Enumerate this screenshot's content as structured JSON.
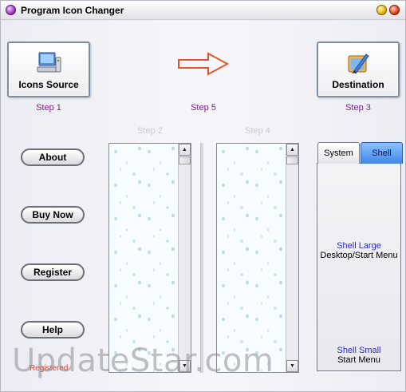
{
  "window": {
    "title": "Program Icon Changer"
  },
  "toolbar": {
    "icons_source_label": "Icons Source",
    "destination_label": "Destination",
    "step1": "Step 1",
    "step5": "Step 5",
    "step3": "Step 3",
    "step2": "Step 2",
    "step4": "Step 4"
  },
  "sidebar": {
    "about": "About",
    "buy_now": "Buy Now",
    "register": "Register",
    "help": "Help"
  },
  "tabs": {
    "system": "System",
    "shell": "Shell"
  },
  "panel": {
    "shell_large": "Shell Large",
    "shell_large_desc": "Desktop/Start Menu",
    "shell_small": "Shell Small",
    "shell_small_desc": "Start Menu"
  },
  "watermark": {
    "text": "UpdateStar.com",
    "red_text": "Registered"
  },
  "colors": {
    "step_accent": "#7b1f8f",
    "shell_tab": "#3f86e6",
    "panel_link": "#2a2acd",
    "arrow_stroke": "#e5532e"
  }
}
